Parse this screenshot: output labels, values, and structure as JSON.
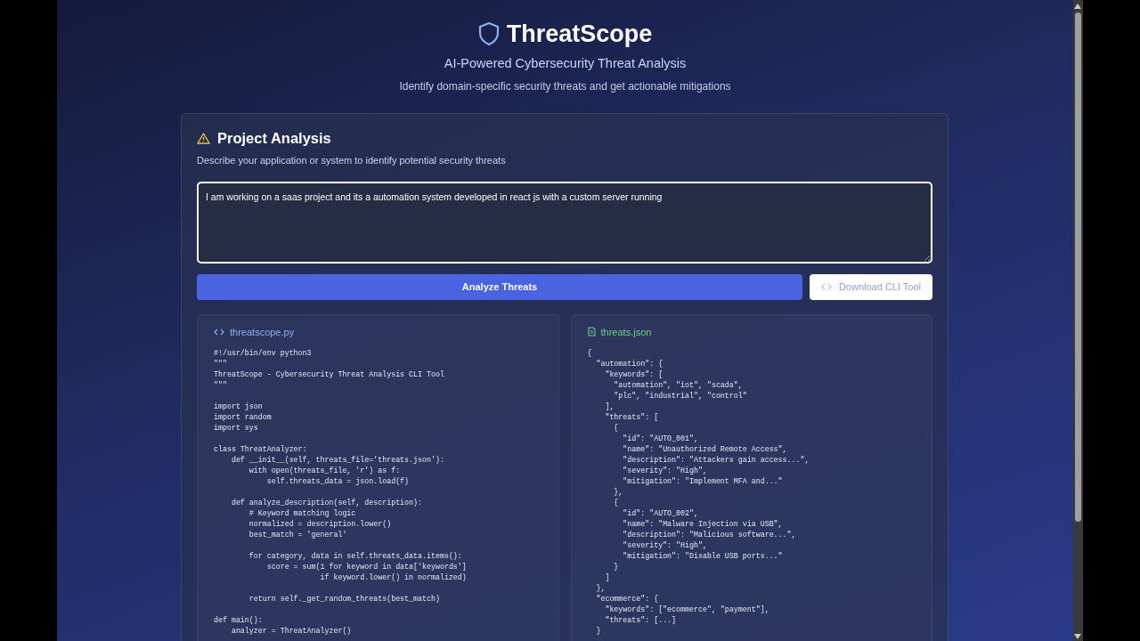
{
  "header": {
    "title": "ThreatScope",
    "subtitle": "AI-Powered Cybersecurity Threat Analysis",
    "tagline": "Identify domain-specific security threats and get actionable mitigations"
  },
  "panel": {
    "title": "Project Analysis",
    "description": "Describe your application or system to identify potential security threats",
    "input": {
      "value": "I am working on a saas project and its a automation system developed in react js with a custom server running"
    },
    "buttons": [
      {
        "label": "Analyze Threats",
        "kind": "primary"
      },
      {
        "label": "Download CLI Tool",
        "kind": "secondary"
      }
    ],
    "files": [
      {
        "name": "threatscope.py",
        "kind": "code",
        "blocks": [
          [
            "#!/usr/bin/env python3",
            "\"\"\"",
            "ThreatScope - Cybersecurity Threat Analysis CLI Tool",
            "\"\"\""
          ],
          [
            "import json",
            "import random",
            "import sys"
          ],
          [
            "class ThreatAnalyzer:",
            "    def __init__(self, threats_file='threats.json'):",
            "        with open(threats_file, 'r') as f:",
            "            self.threats_data = json.load(f)"
          ],
          [
            "    def analyze_description(self, description):",
            "        # Keyword matching logic",
            "        normalized = description.lower()",
            "        best_match = 'general'"
          ],
          [
            "        for category, data in self.threats_data.items():",
            "            score = sum(1 for keyword in data['keywords']",
            "                        if keyword.lower() in normalized)"
          ],
          [
            "        return self._get_random_threats(best_match)"
          ],
          [
            "def main():",
            "    analyzer = ThreatAnalyzer()"
          ]
        ]
      },
      {
        "name": "threats.json",
        "kind": "data",
        "blocks": [
          [
            "{",
            "  \"automation\": {",
            "    \"keywords\": [",
            "      \"automation\", \"iot\", \"scada\",",
            "      \"plc\", \"industrial\", \"control\"",
            "    ],",
            "    \"threats\": [",
            "      {",
            "        \"id\": \"AUTO_001\",",
            "        \"name\": \"Unauthorized Remote Access\",",
            "        \"description\": \"Attackers gain access...\",",
            "        \"severity\": \"High\",",
            "        \"mitigation\": \"Implement MFA and...\"",
            "      },",
            "      {",
            "        \"id\": \"AUTO_002\",",
            "        \"name\": \"Malware Injection via USB\",",
            "        \"description\": \"Malicious software...\",",
            "        \"severity\": \"High\",",
            "        \"mitigation\": \"Disable USB ports...\"",
            "      }",
            "    ]",
            "  },",
            "  \"ecommerce\": {",
            "    \"keywords\": [\"ecommerce\", \"payment\"],",
            "    \"threats\": [...]",
            "  }"
          ]
        ]
      }
    ]
  }
}
